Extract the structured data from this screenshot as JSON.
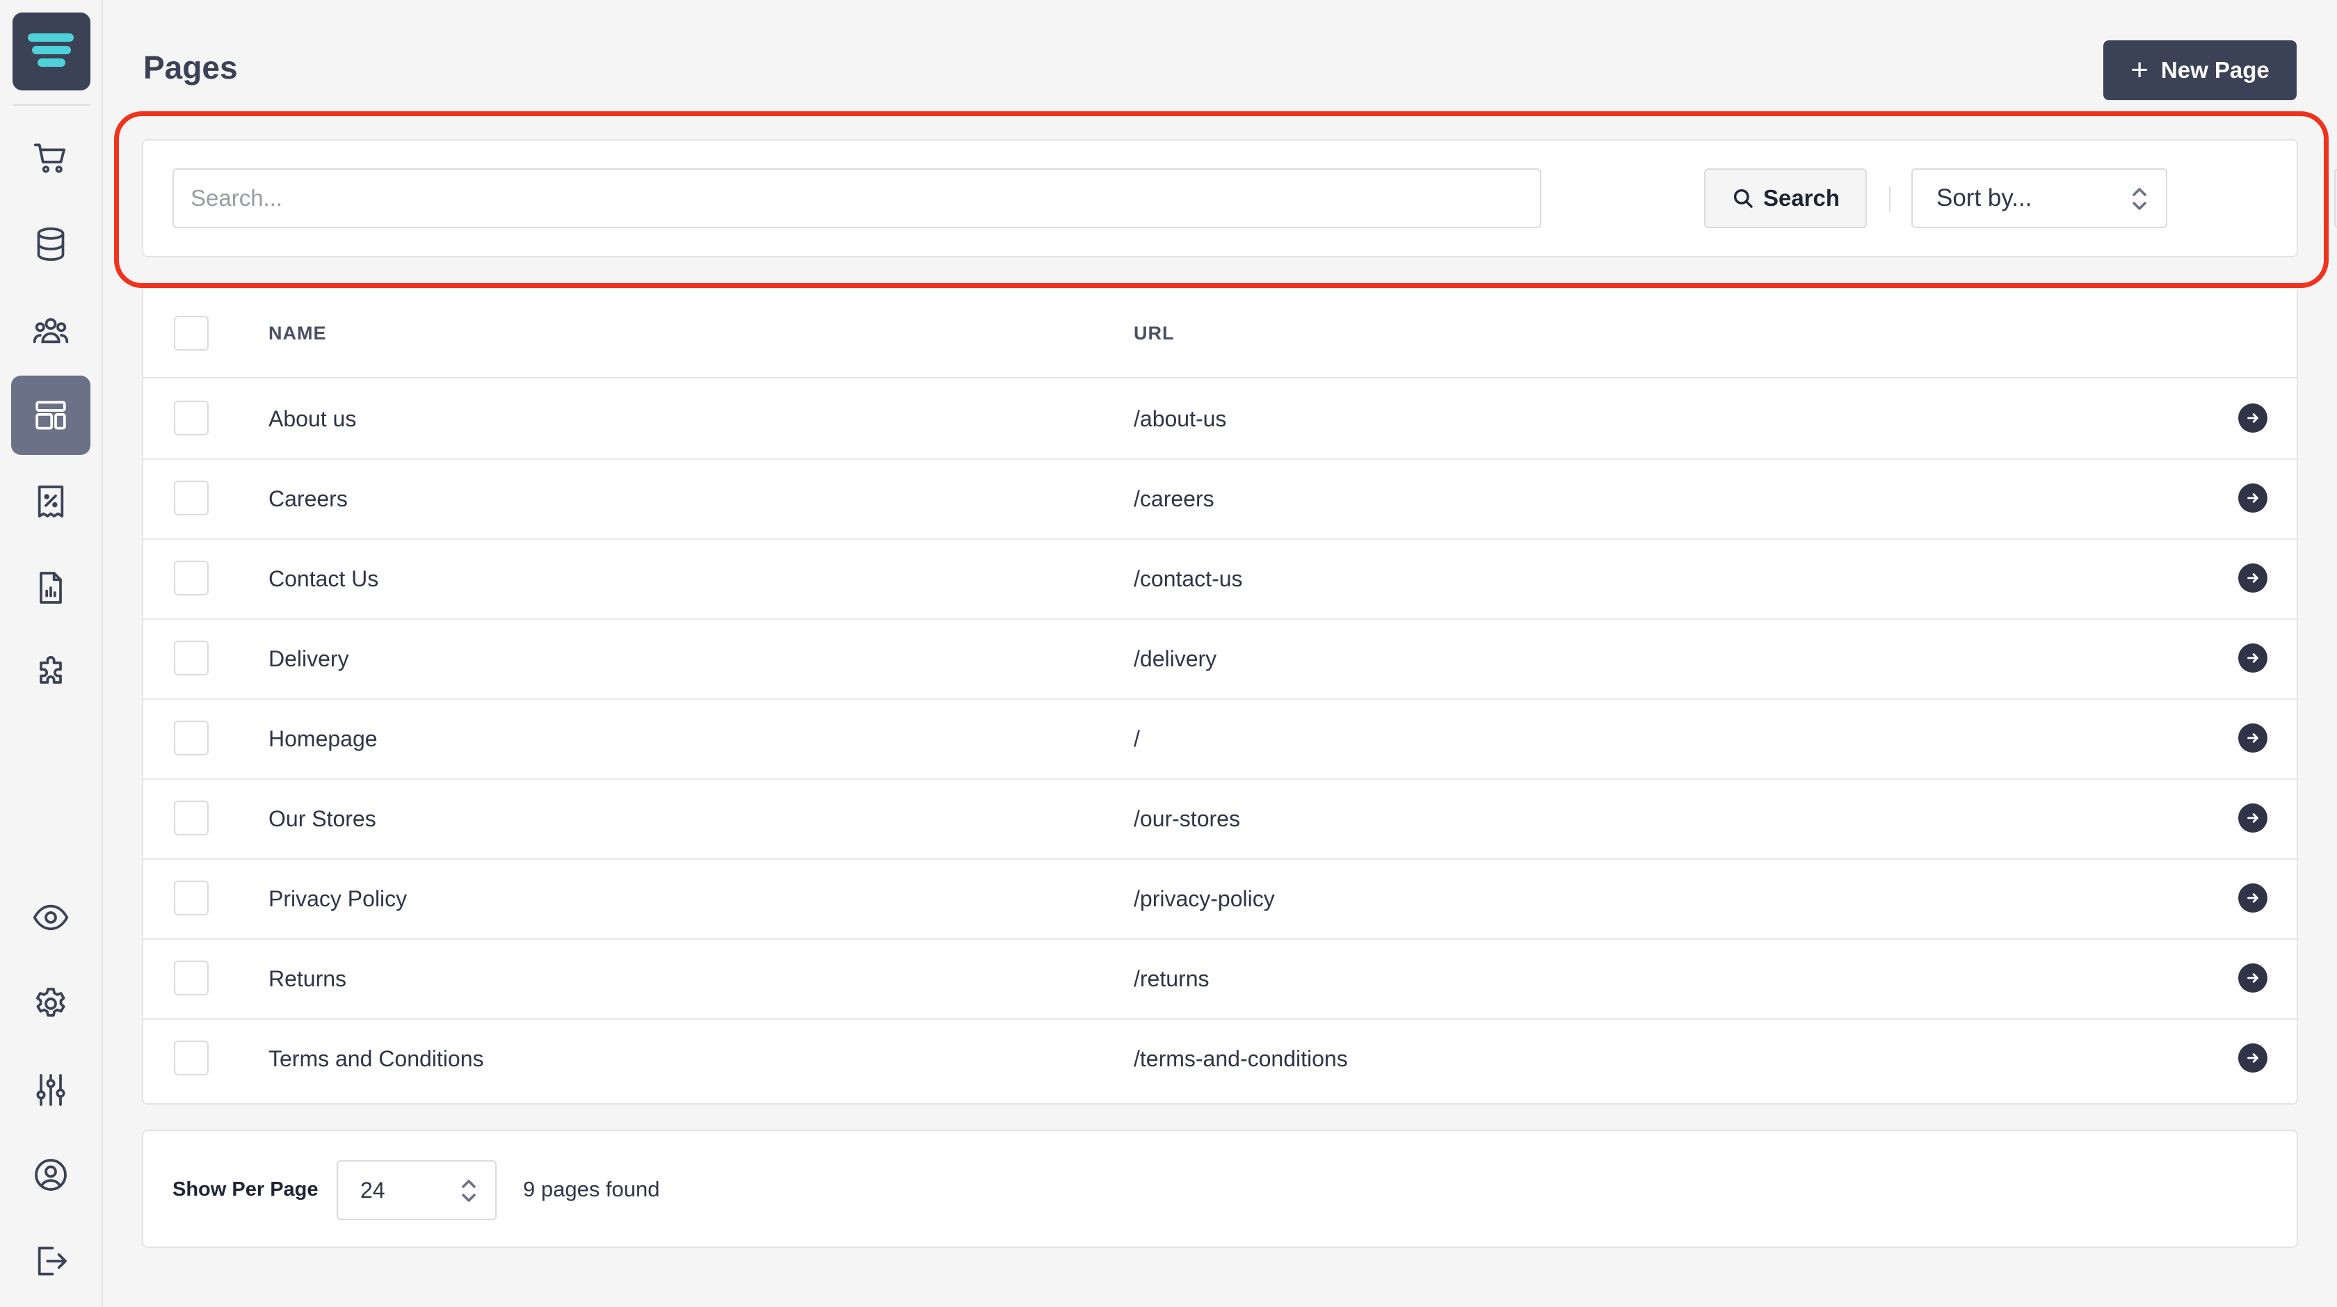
{
  "sidebar": {
    "logo": "stacked-bars-logo",
    "nav_items": [
      {
        "icon": "cart-icon",
        "active": false
      },
      {
        "icon": "database-icon",
        "active": false
      },
      {
        "icon": "users-icon",
        "active": false
      },
      {
        "icon": "layout-icon",
        "active": true
      },
      {
        "icon": "receipt-percent-icon",
        "active": false
      },
      {
        "icon": "report-icon",
        "active": false
      },
      {
        "icon": "puzzle-icon",
        "active": false
      }
    ],
    "bottom_items": [
      {
        "icon": "eye-icon"
      },
      {
        "icon": "gear-icon"
      },
      {
        "icon": "sliders-icon"
      },
      {
        "icon": "user-circle-icon"
      },
      {
        "icon": "logout-icon"
      }
    ]
  },
  "header": {
    "title": "Pages",
    "new_button_label": "New Page"
  },
  "toolbar": {
    "search_placeholder": "Search...",
    "search_value": "",
    "search_button_label": "Search",
    "sort_label": "Sort by...",
    "view_toggle_icon": "card-view-icon"
  },
  "table": {
    "columns": [
      "NAME",
      "URL"
    ],
    "rows": [
      {
        "name": "About us",
        "url": "/about-us"
      },
      {
        "name": "Careers",
        "url": "/careers"
      },
      {
        "name": "Contact Us",
        "url": "/contact-us"
      },
      {
        "name": "Delivery",
        "url": "/delivery"
      },
      {
        "name": "Homepage",
        "url": "/"
      },
      {
        "name": "Our Stores",
        "url": "/our-stores"
      },
      {
        "name": "Privacy Policy",
        "url": "/privacy-policy"
      },
      {
        "name": "Returns",
        "url": "/returns"
      },
      {
        "name": "Terms and Conditions",
        "url": "/terms-and-conditions"
      }
    ]
  },
  "footer": {
    "per_page_label": "Show Per Page",
    "per_page_value": "24",
    "found_text": "9 pages found"
  },
  "colors": {
    "primary": "#3b4256",
    "active_nav": "#6b7186",
    "highlight": "#f0331d",
    "logo_accent": "#4fd1d9"
  }
}
